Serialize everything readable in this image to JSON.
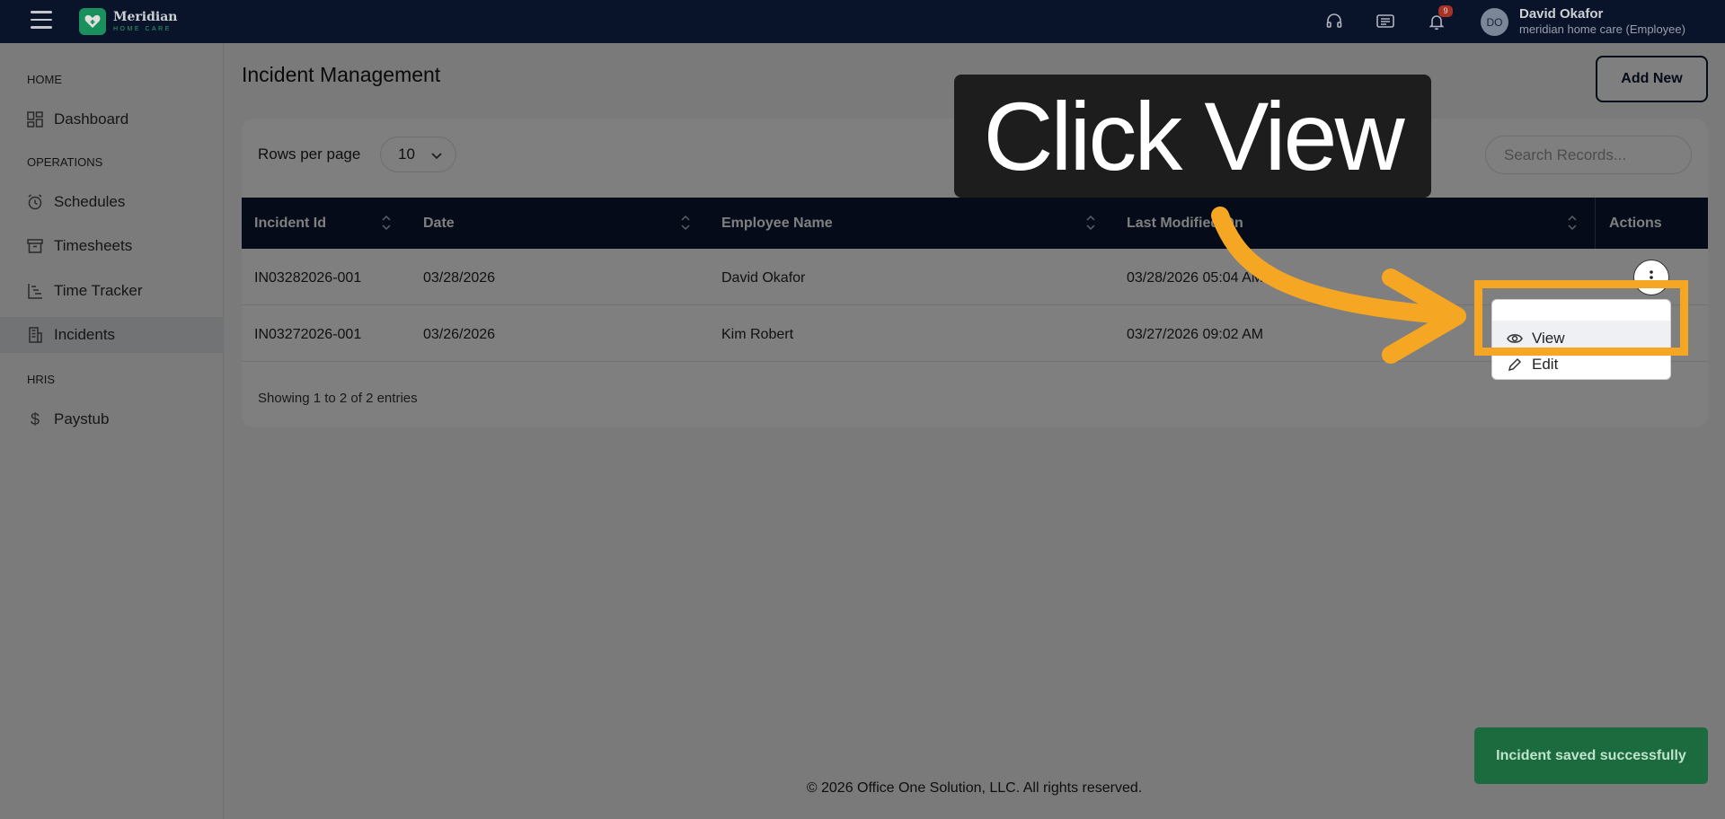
{
  "brand": {
    "name": "Meridian",
    "tagline": "HOME CARE",
    "accent": "#1ea46a",
    "nav_bg": "#0b1730"
  },
  "header": {
    "notification_count": "9",
    "user_initials": "DO",
    "user_name": "David Okafor",
    "user_role": "meridian home care (Employee)",
    "icons": [
      "headset-icon",
      "chat-icon",
      "bell-icon"
    ]
  },
  "sidebar": {
    "sections": [
      {
        "title": "HOME",
        "items": [
          {
            "label": "Dashboard",
            "icon": "dashboard-icon"
          }
        ]
      },
      {
        "title": "OPERATIONS",
        "items": [
          {
            "label": "Schedules",
            "icon": "alarm-clock-icon"
          },
          {
            "label": "Timesheets",
            "icon": "archive-icon"
          },
          {
            "label": "Time Tracker",
            "icon": "gantt-icon"
          },
          {
            "label": "Incidents",
            "icon": "building-icon",
            "active": true
          }
        ]
      },
      {
        "title": "HRIS",
        "items": [
          {
            "label": "Paystub",
            "icon": "dollar-icon"
          }
        ]
      }
    ]
  },
  "main": {
    "title": "Incident Management",
    "add_button": "Add New",
    "rows_per_page_label": "Rows per page",
    "rows_per_page_value": "10",
    "search_placeholder": "Search Records...",
    "columns": [
      "Incident Id",
      "Date",
      "Employee Name",
      "Last Modified On",
      "Actions"
    ],
    "rows": [
      {
        "id": "IN03282026-001",
        "date": "03/28/2026",
        "employee": "David Okafor",
        "modified": "03/28/2026 05:04 AM"
      },
      {
        "id": "IN03272026-001",
        "date": "03/26/2026",
        "employee": "Kim Robert",
        "modified": "03/27/2026 09:02 AM"
      }
    ],
    "actions_menu": [
      "View",
      "Edit"
    ],
    "showing": "Showing 1 to 2 of 2 entries"
  },
  "toast": "Incident saved successfully",
  "footer": "© 2026 Office One Solution, LLC. All rights reserved.",
  "tutorial": {
    "callout": "Click View",
    "highlight_color": "#f5a623"
  }
}
